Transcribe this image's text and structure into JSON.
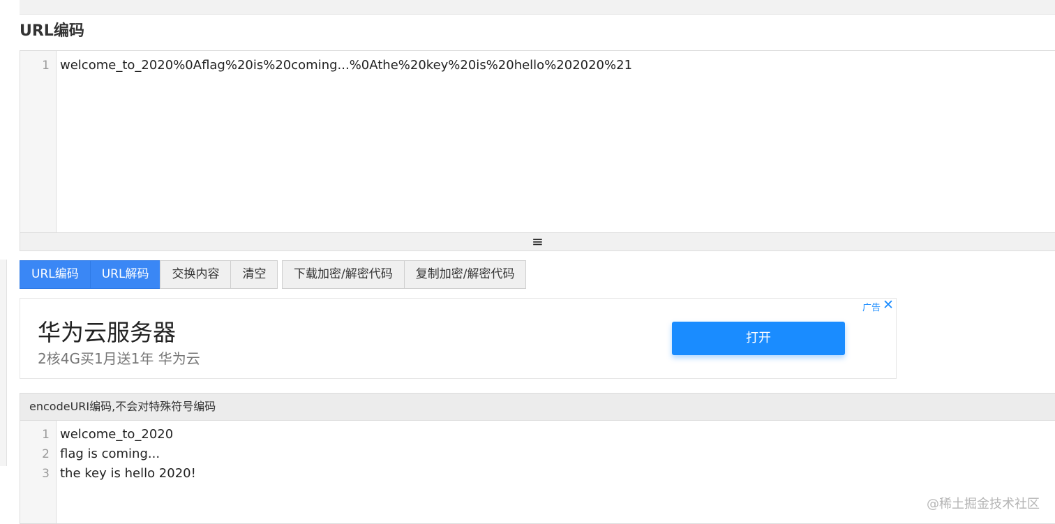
{
  "page": {
    "section_title": "URL编码"
  },
  "input_editor": {
    "lines": [
      {
        "num": "1",
        "text": "welcome_to_2020%0Aflag%20is%20coming...%0Athe%20key%20is%20hello%202020%21"
      }
    ]
  },
  "resize_handle": {
    "icon": "≡"
  },
  "buttons": {
    "encode": "URL编码",
    "decode": "URL解码",
    "swap": "交换内容",
    "clear": "清空",
    "download_code": "下载加密/解密代码",
    "copy_code": "复制加密/解密代码"
  },
  "ad": {
    "title": "华为云服务器",
    "subtitle": "2核4G买1月送1年 华为云",
    "open_button": "打开",
    "label": "广告",
    "close": "✕"
  },
  "output_panel": {
    "header": "encodeURI编码,不会对特殊符号编码",
    "lines": [
      {
        "num": "1",
        "text": "welcome_to_2020"
      },
      {
        "num": "2",
        "text": "flag is coming..."
      },
      {
        "num": "3",
        "text": "the key is hello 2020!"
      }
    ]
  },
  "watermark": "@稀土掘金技术社区",
  "colors": {
    "primary_button": "#3a87f5",
    "ad_button": "#1a8cff"
  }
}
